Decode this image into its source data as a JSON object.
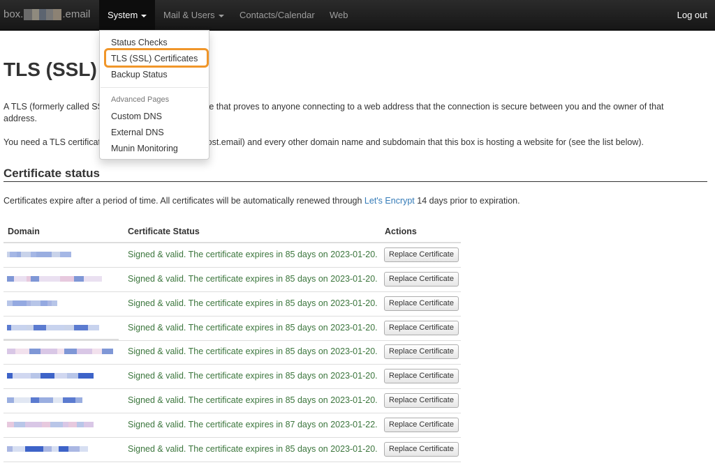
{
  "navbar": {
    "brand_prefix": "box.",
    "brand_suffix": ".email",
    "items": [
      {
        "label": "System"
      },
      {
        "label": "Mail & Users"
      },
      {
        "label": "Contacts/Calendar"
      },
      {
        "label": "Web"
      }
    ],
    "logout": "Log out"
  },
  "dropdown": {
    "items": [
      "Status Checks",
      "TLS (SSL) Certificates",
      "Backup Status"
    ],
    "header": "Advanced Pages",
    "advanced_items": [
      "Custom DNS",
      "External DNS",
      "Munin Monitoring"
    ],
    "highlight_color": "#f0962a"
  },
  "page": {
    "title": "TLS (SSL) C",
    "intro_1a": "A TLS (formerly called SS",
    "intro_1b": "nic file that proves to anyone connecting to a web address that the connection is secure between you and the owner of that",
    "intro_1c": "address.",
    "intro_2a": "You need a TLS certificat",
    "intro_2b": "x.wehost.email) and every other domain name and subdomain that this box is hosting a website for (see the list below).",
    "section_title": "Certificate status",
    "expire_text_a": "Certificates expire after a period of time. All certificates will be automatically renewed through ",
    "expire_link": "Let's Encrypt",
    "expire_text_b": " 14 days prior to expiration."
  },
  "table": {
    "headers": [
      "Domain",
      "Certificate Status",
      "Actions"
    ],
    "button_label": "Replace Certificate",
    "status_color": "#3c763d",
    "rows": [
      {
        "status": "Signed & valid. The certificate expires in 85 days on 2023-01-20."
      },
      {
        "status": "Signed & valid. The certificate expires in 85 days on 2023-01-20."
      },
      {
        "status": "Signed & valid. The certificate expires in 85 days on 2023-01-20."
      },
      {
        "status": "Signed & valid. The certificate expires in 85 days on 2023-01-20."
      },
      {
        "status": "Signed & valid. The certificate expires in 85 days on 2023-01-20."
      },
      {
        "status": "Signed & valid. The certificate expires in 85 days on 2023-01-20."
      },
      {
        "status": "Signed & valid. The certificate expires in 85 days on 2023-01-20."
      },
      {
        "status": "Signed & valid. The certificate expires in 87 days on 2023-01-22."
      },
      {
        "status": "Signed & valid. The certificate expires in 85 days on 2023-01-20."
      }
    ]
  }
}
